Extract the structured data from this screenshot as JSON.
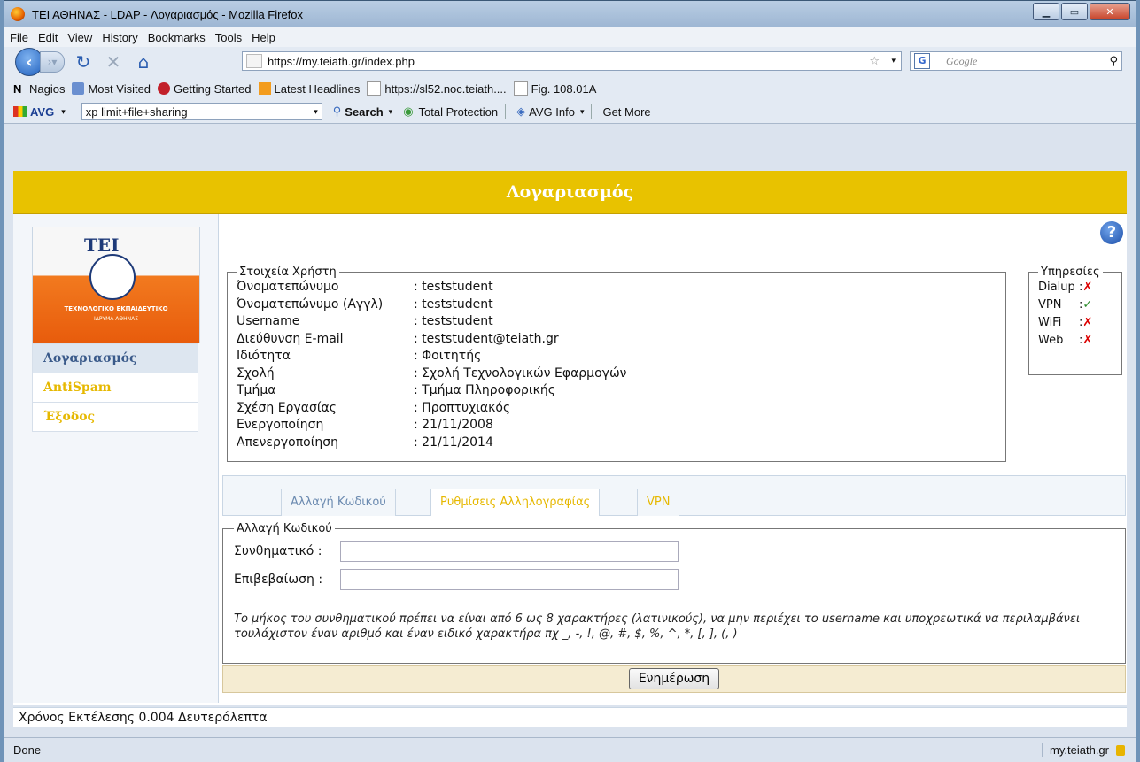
{
  "window": {
    "title": "ΤΕΙ ΑΘΗΝΑΣ - LDAP - Λογαριασμός - Mozilla Firefox"
  },
  "menu": [
    "File",
    "Edit",
    "View",
    "History",
    "Bookmarks",
    "Tools",
    "Help"
  ],
  "nav": {
    "url": "https://my.teiath.gr/index.php",
    "search_placeholder": "Google"
  },
  "bookmarks": [
    "Nagios",
    "Most Visited",
    "Getting Started",
    "Latest Headlines",
    "https://sl52.noc.teiath....",
    "Fig. 108.01A"
  ],
  "avg": {
    "logo": "AVG",
    "query": "xp limit+file+sharing",
    "search": "Search",
    "total": "Total Protection",
    "info": "AVG Info",
    "more": "Get More"
  },
  "page": {
    "header": "Λογαριασμός",
    "logo": {
      "name": "ΤΕΙ",
      "line1": "ΤΕΧΝΟΛΟΓΙΚΟ ΕΚΠΑΙΔΕΥΤΙΚΟ",
      "line2": "ΙΔΡΥΜΑ ΑΘΗΝΑΣ"
    },
    "leftnav": [
      "Λογαριασμός",
      "AntiSpam",
      "Έξοδος"
    ],
    "user_info": {
      "legend": "Στοιχεία Χρήστη",
      "rows": [
        {
          "k": "Όνοματεπώνυμο",
          "v": ": teststudent"
        },
        {
          "k": "Όνοματεπώνυμο (Αγγλ)",
          "v": ": teststudent"
        },
        {
          "k": "Username",
          "v": ": teststudent"
        },
        {
          "k": "Διεύθυνση E-mail",
          "v": ": teststudent@teiath.gr"
        },
        {
          "k": "Ιδιότητα",
          "v": ": Φοιτητής"
        },
        {
          "k": "Σχολή",
          "v": ": Σχολή Τεχνολογικών Εφαρμογών"
        },
        {
          "k": "Τμήμα",
          "v": ": Τμήμα Πληροφορικής"
        },
        {
          "k": "Σχέση Εργασίας",
          "v": ": Προπτυχιακός"
        },
        {
          "k": "Ενεργοποίηση",
          "v": ": 21/11/2008"
        },
        {
          "k": "Απενεργοποίηση",
          "v": ": 21/11/2014"
        }
      ]
    },
    "services": {
      "legend": "Υπηρεσίες",
      "rows": [
        {
          "k": "Dialup",
          "sep": ":",
          "status": "✗"
        },
        {
          "k": "VPN",
          "sep": ":",
          "status": "✓"
        },
        {
          "k": "WiFi",
          "sep": ":",
          "status": "✗"
        },
        {
          "k": "Web",
          "sep": ":",
          "status": "✗"
        }
      ]
    },
    "tabs": [
      "Αλλαγή Κωδικού",
      "Ρυθμίσεις Αλληλογραφίας",
      "VPN"
    ],
    "password": {
      "legend": "Αλλαγή Κωδικού",
      "label1": "Συνθηματικό :",
      "label2": "Επιβεβαίωση :",
      "note": "Το μήκος του συνθηματικού πρέπει να είναι από 6 ως 8 χαρακτήρες (λατινικούς), να μην περιέχει το username και υποχρεωτικά να περιλαμβάνει τουλάχιστον έναν αριθμό και έναν ειδικό χαρακτήρα πχ _, -, !, @, #, $, %, ^, *, [, ], (, )",
      "button": "Ενημέρωση"
    },
    "exec_time": "Χρόνος Εκτέλεσης 0.004 Δευτερόλεπτα"
  },
  "status": {
    "left": "Done",
    "host": "my.teiath.gr"
  }
}
